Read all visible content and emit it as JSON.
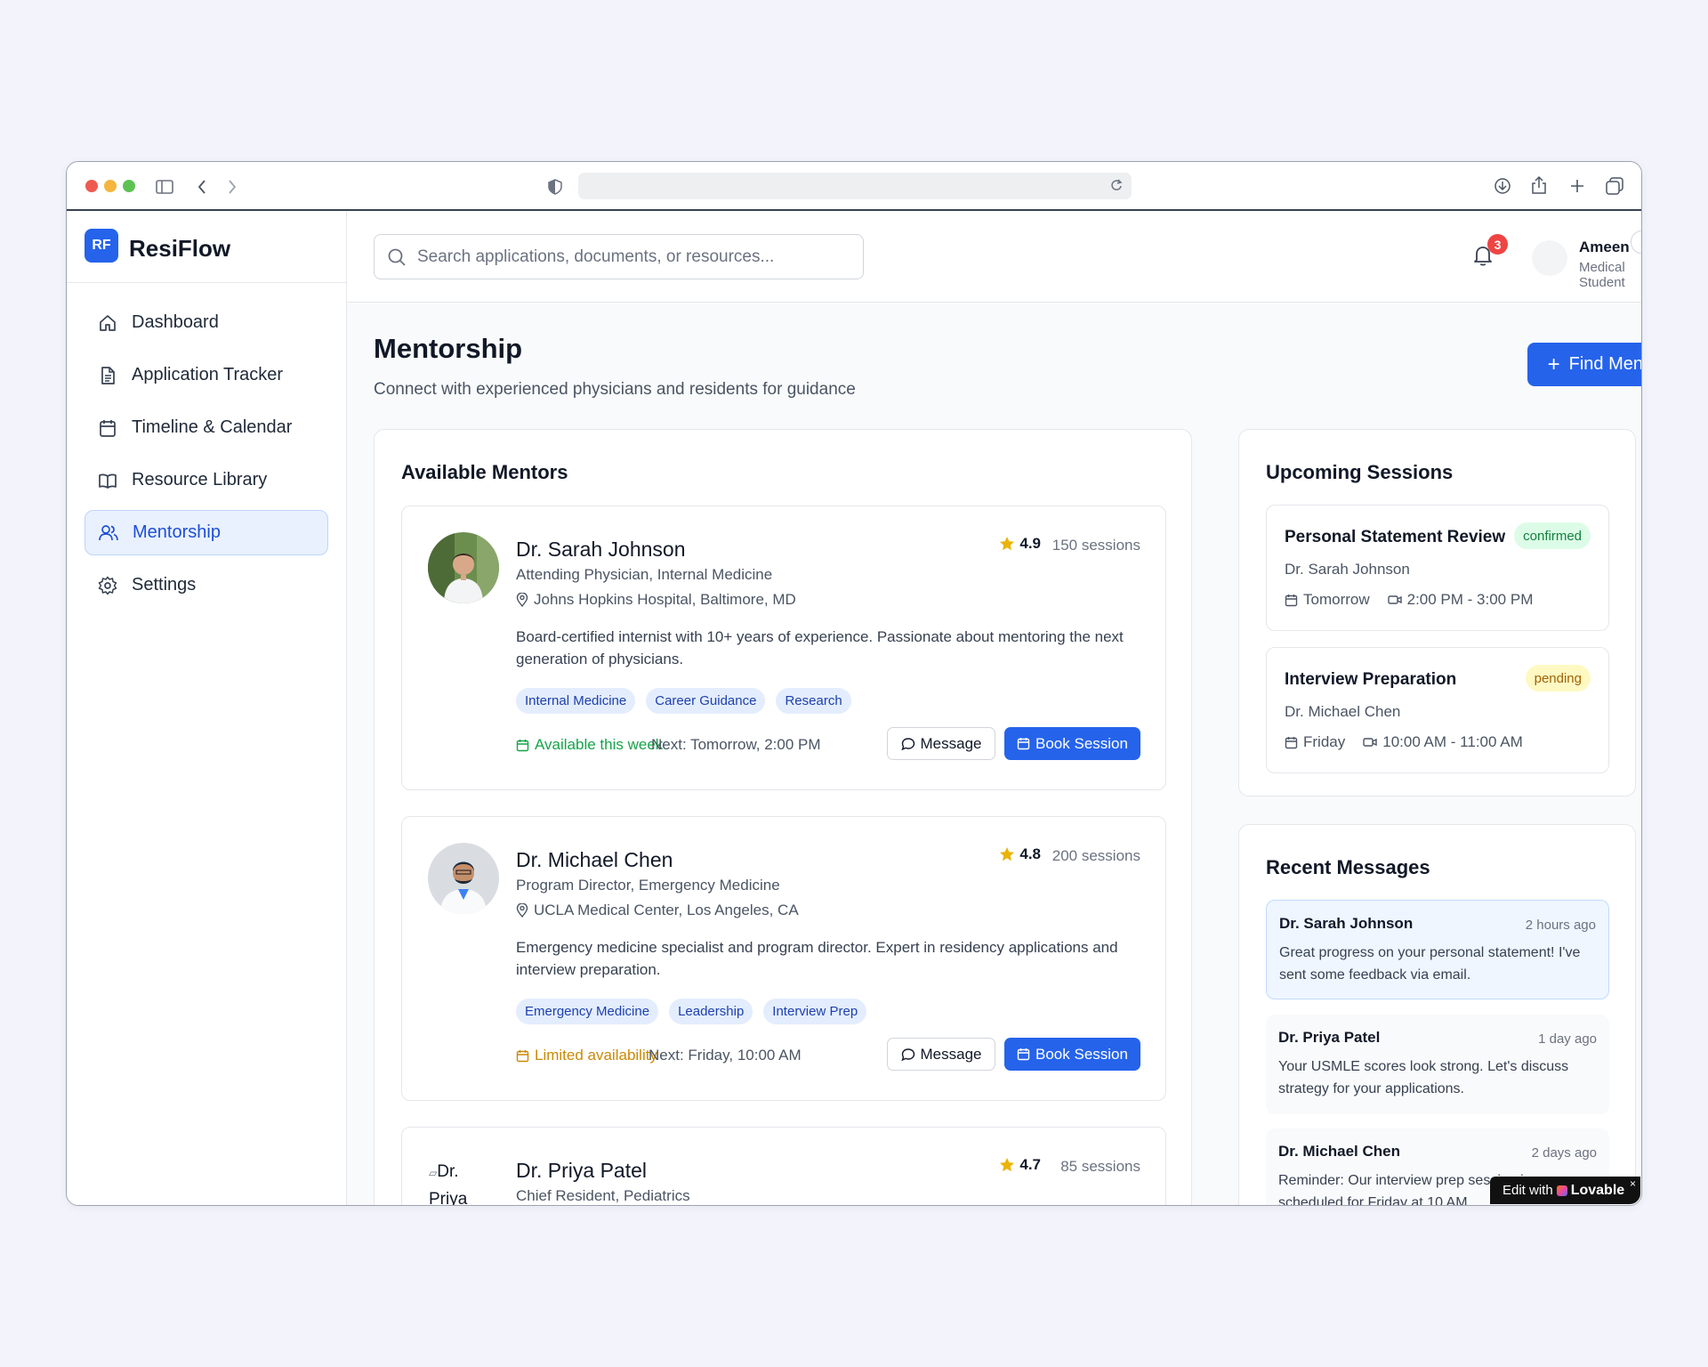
{
  "brand": {
    "logo": "RF",
    "name": "ResiFlow"
  },
  "nav": [
    {
      "label": "Dashboard",
      "icon": "home-icon",
      "active": false
    },
    {
      "label": "Application Tracker",
      "icon": "document-icon",
      "active": false
    },
    {
      "label": "Timeline & Calendar",
      "icon": "calendar-icon",
      "active": false
    },
    {
      "label": "Resource Library",
      "icon": "book-icon",
      "active": false
    },
    {
      "label": "Mentorship",
      "icon": "users-icon",
      "active": true
    },
    {
      "label": "Settings",
      "icon": "gear-icon",
      "active": false
    }
  ],
  "search": {
    "placeholder": "Search applications, documents, or resources..."
  },
  "notifications": {
    "count": "3"
  },
  "user": {
    "name": "Ameen",
    "role": "Medical Student"
  },
  "page": {
    "title": "Mentorship",
    "subtitle": "Connect with experienced physicians and residents for guidance",
    "find_mentor_label": "Find Mentor"
  },
  "mentors_panel": {
    "title": "Available Mentors",
    "mentors": [
      {
        "name": "Dr. Sarah Johnson",
        "role": "Attending Physician, Internal Medicine",
        "location": "Johns Hopkins Hospital, Baltimore, MD",
        "rating": "4.9",
        "sessions": "150 sessions",
        "bio": "Board-certified internist with 10+ years of experience. Passionate about mentoring the next generation of physicians.",
        "tags": [
          "Internal Medicine",
          "Career Guidance",
          "Research"
        ],
        "availability": "Available this week",
        "availability_color": "#16a34a",
        "next": "Next: Tomorrow, 2:00 PM",
        "message_label": "Message",
        "book_label": "Book Session"
      },
      {
        "name": "Dr. Michael Chen",
        "role": "Program Director, Emergency Medicine",
        "location": "UCLA Medical Center, Los Angeles, CA",
        "rating": "4.8",
        "sessions": "200 sessions",
        "bio": "Emergency medicine specialist and program director. Expert in residency applications and interview preparation.",
        "tags": [
          "Emergency Medicine",
          "Leadership",
          "Interview Prep"
        ],
        "availability": "Limited availability",
        "availability_color": "#ca8a04",
        "next": "Next: Friday, 10:00 AM",
        "message_label": "Message",
        "book_label": "Book Session"
      },
      {
        "name": "Dr. Priya Patel",
        "role": "Chief Resident, Pediatrics",
        "rating": "4.7",
        "sessions": "85 sessions",
        "image_alt": "Dr. Priya"
      }
    ]
  },
  "sessions_panel": {
    "title": "Upcoming Sessions",
    "sessions": [
      {
        "title": "Personal Statement Review",
        "status": "confirmed",
        "mentor": "Dr. Sarah Johnson",
        "day": "Tomorrow",
        "time": "2:00 PM - 3:00 PM"
      },
      {
        "title": "Interview Preparation",
        "status": "pending",
        "mentor": "Dr. Michael Chen",
        "day": "Friday",
        "time": "10:00 AM - 11:00 AM"
      }
    ]
  },
  "messages_panel": {
    "title": "Recent Messages",
    "messages": [
      {
        "from": "Dr. Sarah Johnson",
        "time": "2 hours ago",
        "text": "Great progress on your personal statement! I've sent some feedback via email."
      },
      {
        "from": "Dr. Priya Patel",
        "time": "1 day ago",
        "text": "Your USMLE scores look strong. Let's discuss strategy for your applications."
      },
      {
        "from": "Dr. Michael Chen",
        "time": "2 days ago",
        "text": "Reminder: Our interview prep session is scheduled for Friday at 10 AM."
      }
    ]
  },
  "lovable": {
    "prefix": "Edit with",
    "brand": "Lovable",
    "close": "×"
  },
  "colors": {
    "accent": "#2563eb",
    "active_nav_bg": "#e9f1fe",
    "badge": "#ef4444"
  }
}
